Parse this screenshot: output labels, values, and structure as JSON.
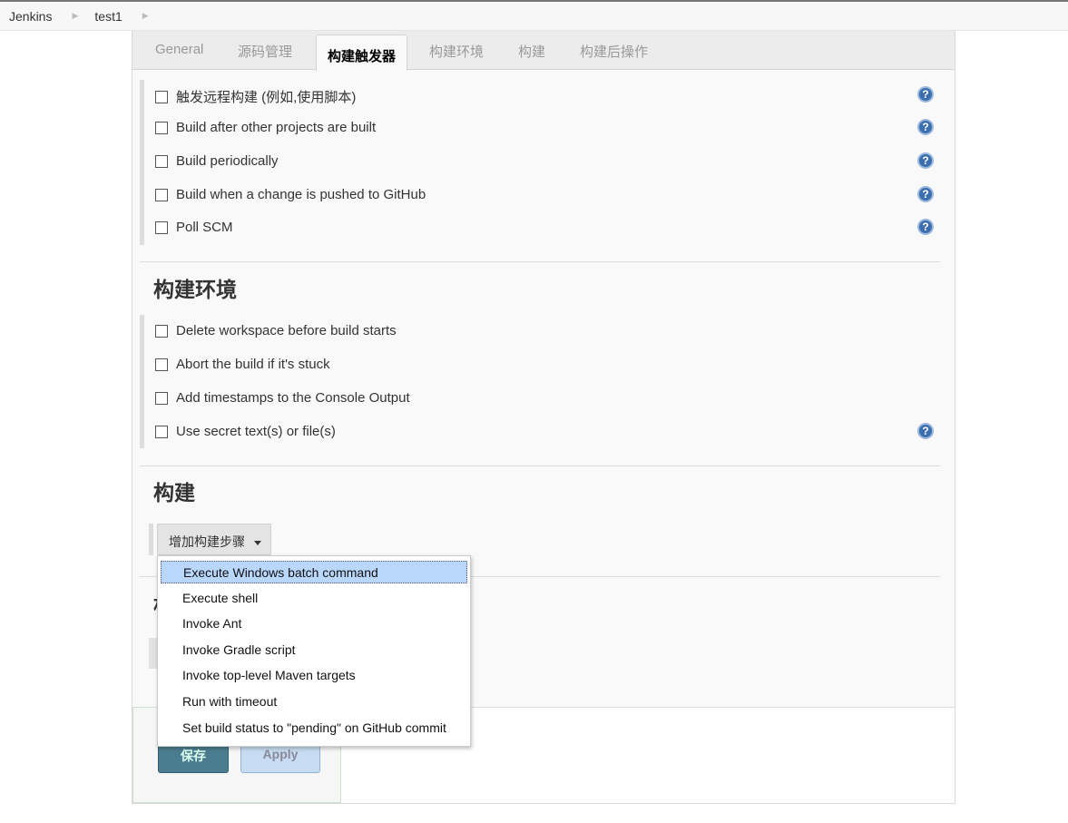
{
  "breadcrumb": [
    "Jenkins",
    "test1"
  ],
  "tabs": [
    {
      "label": "General"
    },
    {
      "label": "源码管理"
    },
    {
      "label": "构建触发器"
    },
    {
      "label": "构建环境"
    },
    {
      "label": "构建"
    },
    {
      "label": "构建后操作"
    }
  ],
  "active_tab": "构建触发器",
  "triggers": [
    {
      "label": "触发远程构建 (例如,使用脚本)",
      "checked": false,
      "help": true
    },
    {
      "label": "Build after other projects are built",
      "checked": false,
      "help": true
    },
    {
      "label": "Build periodically",
      "checked": false,
      "help": true
    },
    {
      "label": "Build when a change is pushed to GitHub",
      "checked": false,
      "help": true
    },
    {
      "label": "Poll SCM",
      "checked": false,
      "help": true
    }
  ],
  "env": {
    "title": "构建环境",
    "options": [
      {
        "label": "Delete workspace before build starts",
        "checked": false,
        "help": false
      },
      {
        "label": "Abort the build if it's stuck",
        "checked": false,
        "help": false
      },
      {
        "label": "Add timestamps to the Console Output",
        "checked": false,
        "help": false
      },
      {
        "label": "Use secret text(s) or file(s)",
        "checked": false,
        "help": true
      }
    ]
  },
  "build": {
    "title": "构建",
    "add_step": "增加构建步骤"
  },
  "post_build_title": "构",
  "menu": {
    "items": [
      "Execute Windows batch command",
      "Execute shell",
      "Invoke Ant",
      "Invoke Gradle script",
      "Invoke top-level Maven targets",
      "Run with timeout",
      "Set build status to \"pending\" on GitHub commit"
    ],
    "selected": "Execute Windows batch command"
  },
  "footer": {
    "save": "保存",
    "apply": "Apply"
  },
  "help_icon": "?",
  "colors": {
    "save": "#4a7d8f",
    "apply": "#c7dcf2",
    "menu_highlight": "#b9d6fb",
    "help": "#3c6fb0"
  }
}
